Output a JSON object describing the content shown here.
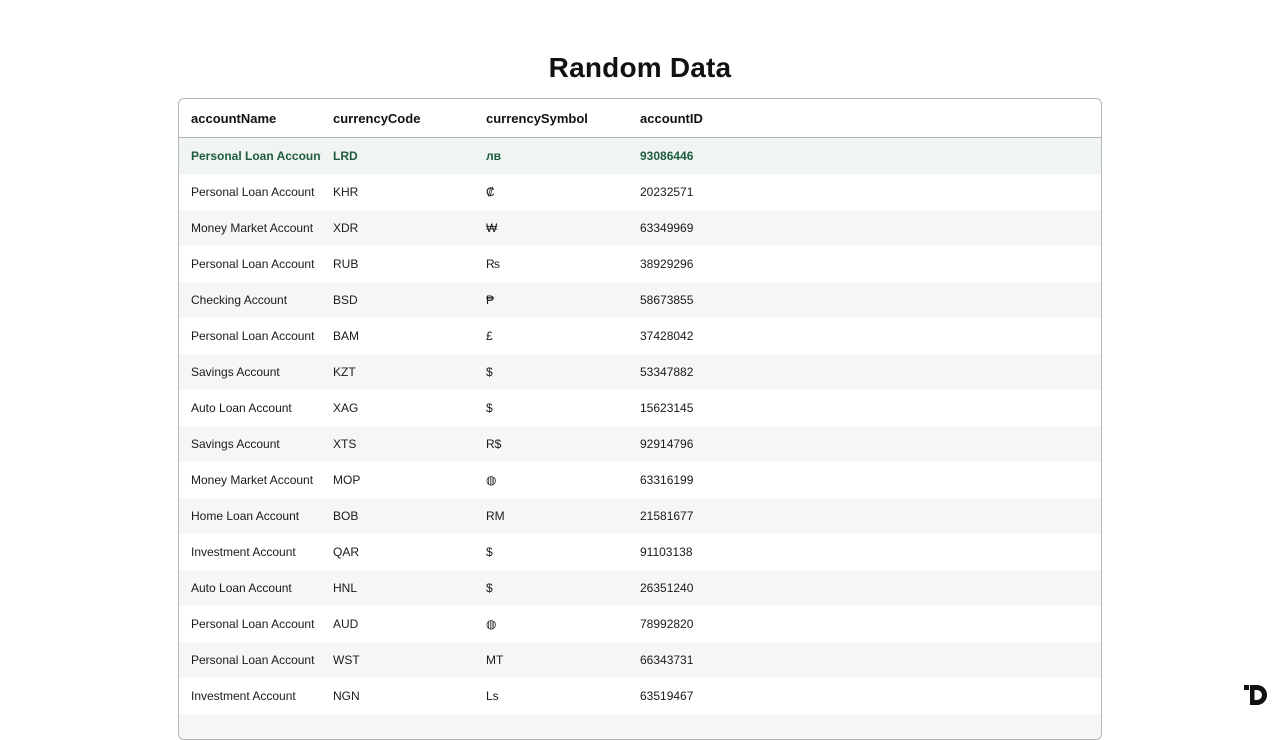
{
  "page": {
    "title": "Random Data"
  },
  "table": {
    "columns": [
      "accountName",
      "currencyCode",
      "currencySymbol",
      "accountID"
    ],
    "rows": [
      [
        "Personal Loan Account",
        "LRD",
        "лв",
        "93086446"
      ],
      [
        "Personal Loan Account",
        "KHR",
        "₡",
        "20232571"
      ],
      [
        "Money Market Account",
        "XDR",
        "₩",
        "63349969"
      ],
      [
        "Personal Loan Account",
        "RUB",
        "₨",
        "38929296"
      ],
      [
        "Checking Account",
        "BSD",
        "₱",
        "58673855"
      ],
      [
        "Personal Loan Account",
        "BAM",
        "£",
        "37428042"
      ],
      [
        "Savings Account",
        "KZT",
        "$",
        "53347882"
      ],
      [
        "Auto Loan Account",
        "XAG",
        "$",
        "15623145"
      ],
      [
        "Savings Account",
        "XTS",
        "R$",
        "92914796"
      ],
      [
        "Money Market Account",
        "MOP",
        "◍",
        "63316199"
      ],
      [
        "Home Loan Account",
        "BOB",
        "RM",
        "21581677"
      ],
      [
        "Investment Account",
        "QAR",
        "$",
        "91103138"
      ],
      [
        "Auto Loan Account",
        "HNL",
        "$",
        "26351240"
      ],
      [
        "Personal Loan Account",
        "AUD",
        "◍",
        "78992820"
      ],
      [
        "Personal Loan Account",
        "WST",
        "MT",
        "66343731"
      ],
      [
        "Investment Account",
        "NGN",
        "Ls",
        "63519467"
      ],
      [
        "",
        "",
        "",
        ""
      ]
    ],
    "selected_row_index": 0
  },
  "colors": {
    "selected_text": "#1f5c3f",
    "selected_bg": "#f0f5f2",
    "stripe_bg": "#f6f6f6",
    "border": "#b5b5b5"
  },
  "icons": {
    "brand": "brand-logo-icon"
  }
}
